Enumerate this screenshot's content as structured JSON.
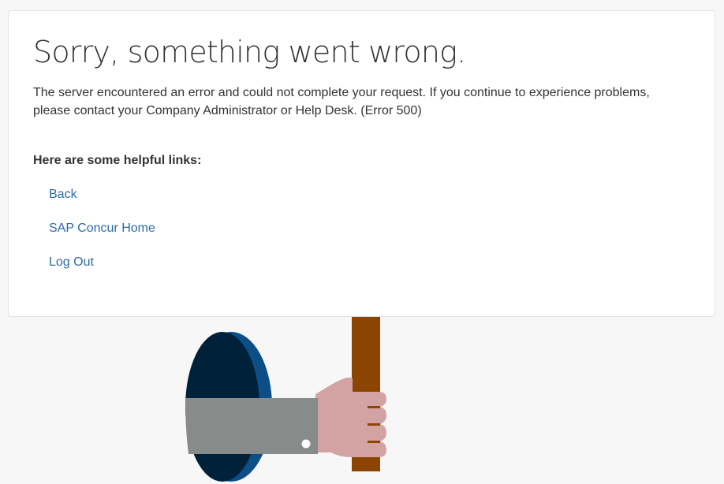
{
  "error": {
    "title": "Sorry, something went wrong.",
    "message": "The server encountered an error and could not complete your request. If you continue to experience problems, please contact your Company Administrator or Help Desk. (Error 500)"
  },
  "links": {
    "heading": "Here are some helpful links:",
    "items": [
      {
        "label": "Back"
      },
      {
        "label": "SAP Concur Home"
      },
      {
        "label": "Log Out"
      }
    ]
  },
  "colors": {
    "background": "#f7f7f7",
    "card": "#ffffff",
    "text": "#333333",
    "link": "#2d6aa5",
    "hole_dark": "#00213a",
    "hole_rim": "#0b4f86",
    "sleeve": "#878b8a",
    "hand": "#d3a3a3",
    "stick": "#8b4500"
  }
}
